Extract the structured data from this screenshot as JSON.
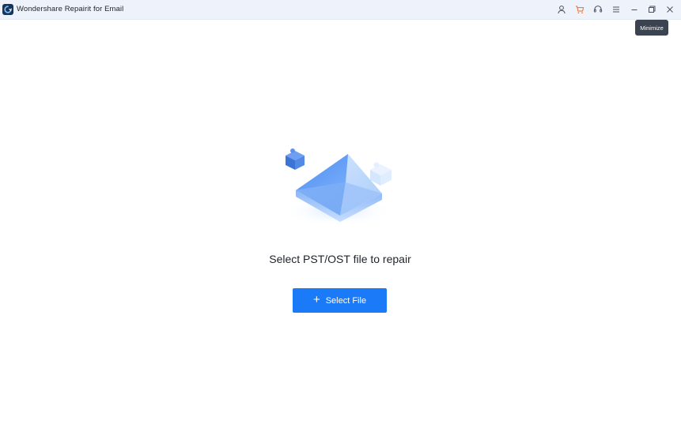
{
  "app": {
    "title": "Wondershare Repairit for Email"
  },
  "titlebar": {
    "icons": [
      "account-icon",
      "cart-icon",
      "support-icon",
      "menu-icon",
      "minimize-icon",
      "restore-icon",
      "close-icon"
    ],
    "tooltip": "Minimize"
  },
  "main": {
    "heading": "Select PST/OST file to repair",
    "select_button": {
      "icon": "+",
      "label": "Select File"
    }
  },
  "colors": {
    "accent": "#1a7af8",
    "titlebar_bg": "#eef3fb",
    "cart": "#f06a2a",
    "tooltip_bg": "#3b4350"
  }
}
